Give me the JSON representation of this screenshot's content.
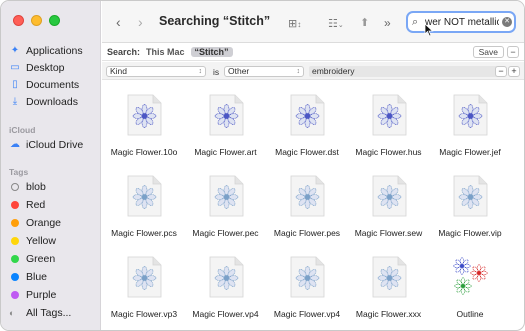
{
  "window": {
    "title": "Searching “Stitch”"
  },
  "sidebar": {
    "favorites": [
      {
        "label": "Applications",
        "icon": "applications-icon"
      },
      {
        "label": "Desktop",
        "icon": "desktop-icon"
      },
      {
        "label": "Documents",
        "icon": "documents-icon"
      },
      {
        "label": "Downloads",
        "icon": "downloads-icon"
      }
    ],
    "icloud_header": "iCloud",
    "icloud": [
      {
        "label": "iCloud Drive",
        "icon": "cloud-icon"
      }
    ],
    "tags_header": "Tags",
    "tags": [
      {
        "label": "blob",
        "color": "none"
      },
      {
        "label": "Red",
        "color": "#ff453a"
      },
      {
        "label": "Orange",
        "color": "#ff9f0a"
      },
      {
        "label": "Yellow",
        "color": "#ffd60a"
      },
      {
        "label": "Green",
        "color": "#32d74b"
      },
      {
        "label": "Blue",
        "color": "#0a84ff"
      },
      {
        "label": "Purple",
        "color": "#bf5af2"
      },
      {
        "label": "All Tags...",
        "color": "all"
      }
    ]
  },
  "search": {
    "query": "wer NOT metallic"
  },
  "scope": {
    "label": "Search:",
    "this_mac": "This Mac",
    "selected": "“Stitch”",
    "save": "Save",
    "minus": "−"
  },
  "criteria": {
    "attribute": "Kind",
    "operator": "is",
    "kind": "Other",
    "value": "embroidery",
    "minus": "−",
    "plus": "+"
  },
  "files": [
    {
      "name": "Magic Flower.10o"
    },
    {
      "name": "Magic Flower.art"
    },
    {
      "name": "Magic Flower.dst"
    },
    {
      "name": "Magic Flower.hus"
    },
    {
      "name": "Magic Flower.jef"
    },
    {
      "name": "Magic Flower.pcs"
    },
    {
      "name": "Magic Flower.pec"
    },
    {
      "name": "Magic Flower.pes"
    },
    {
      "name": "Magic Flower.sew"
    },
    {
      "name": "Magic Flower.vip"
    },
    {
      "name": "Magic Flower.vp3"
    },
    {
      "name": "Magic Flower.vp4"
    },
    {
      "name": "Magic Flower.vp4"
    },
    {
      "name": "Magic Flower.xxx"
    },
    {
      "name": "Outline"
    }
  ],
  "accent": "#3b82f6"
}
